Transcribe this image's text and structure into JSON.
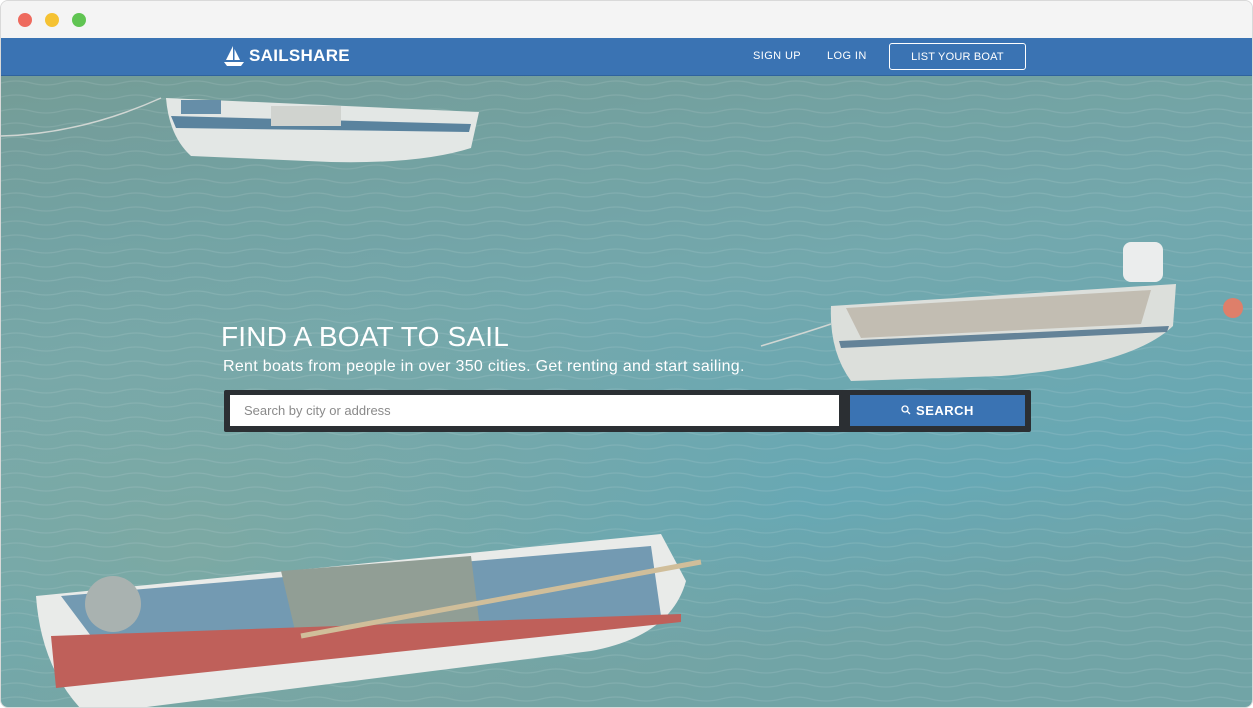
{
  "window": {
    "controls": [
      "close",
      "minimize",
      "maximize"
    ]
  },
  "navbar": {
    "brand": "SAILSHARE",
    "logo_icon": "sailboat-icon",
    "links": {
      "signup": "SIGN UP",
      "login": "LOG IN"
    },
    "cta": "LIST YOUR BOAT",
    "color": "#3a73b3"
  },
  "hero": {
    "title": "FIND A BOAT TO SAIL",
    "subtitle": "Rent boats from people in over 350 cities. Get renting and start sailing.",
    "background": "boats-on-water-photo",
    "search": {
      "placeholder": "Search by city or address",
      "value": "",
      "button_label": "SEARCH",
      "button_icon": "search-icon"
    }
  }
}
